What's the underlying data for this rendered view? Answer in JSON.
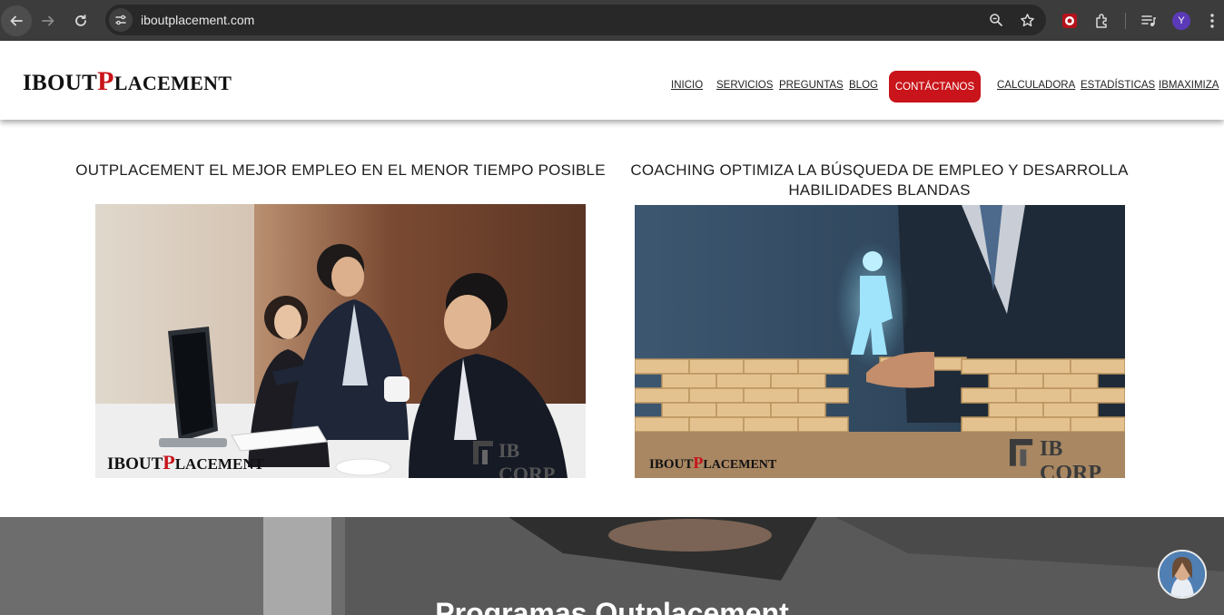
{
  "browser": {
    "url": "iboutplacement.com",
    "profile_initial": "Y",
    "icons": [
      "back-arrow-icon",
      "forward-arrow-icon",
      "reload-icon",
      "site-info-icon",
      "zoom-icon",
      "bookmark-star-icon",
      "extension-icon",
      "puzzle-icon",
      "media-icon",
      "menu-dots-icon"
    ]
  },
  "site": {
    "logo": {
      "part1": "IBOUT",
      "p": "P",
      "part2": "LACEMENT"
    },
    "nav": {
      "inicio": "INICIO",
      "servicios": "SERVICIOS",
      "preguntas": "PREGUNTAS",
      "blog": "BLOG",
      "contactanos": "CONTÁCTANOS",
      "calculadora": "CALCULADORA",
      "estadisticas": "ESTADÍSTICAS",
      "ibmaximiza": "IBMAXIMIZA"
    },
    "brand_color": "#c8141a"
  },
  "cards": [
    {
      "title": "OUTPLACEMENT EL MEJOR EMPLEO EN EL MENOR TIEMPO POSIBLE",
      "watermark": {
        "part1": "IBOUT",
        "p": "P",
        "part2": "LACEMENT"
      },
      "corp": "IB CORP"
    },
    {
      "title": "COACHING OPTIMIZA LA BÚSQUEDA DE EMPLEO Y DESARROLLA HABILIDADES BLANDAS",
      "watermark": {
        "part1": "IBOUT",
        "p": "P",
        "part2": "LACEMENT"
      },
      "corp": "IB CORP"
    }
  ],
  "section": {
    "heading": "Programas Outplacement"
  }
}
